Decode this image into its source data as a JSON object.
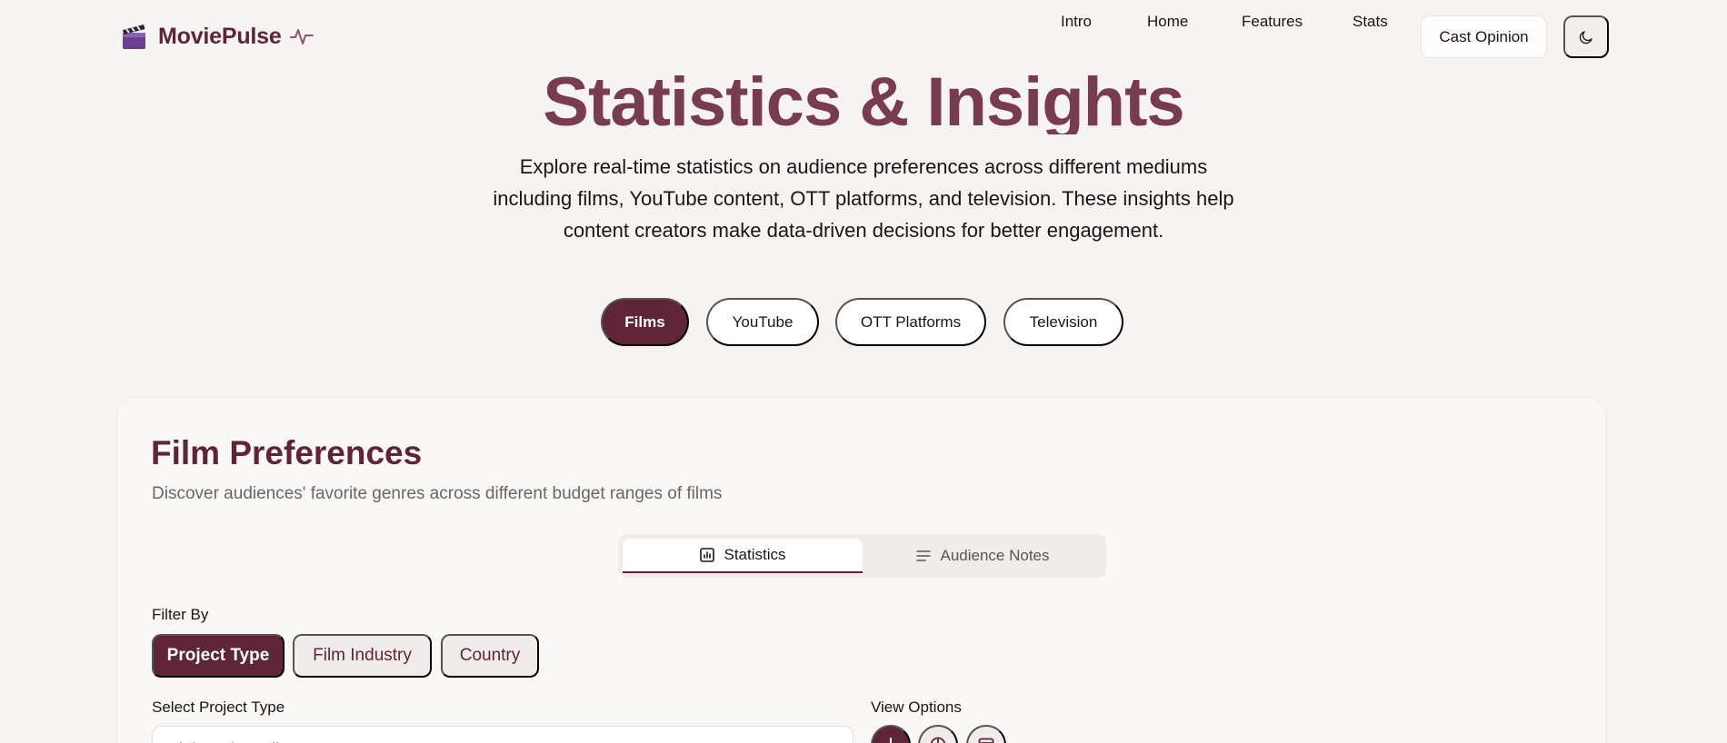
{
  "app": {
    "name": "MoviePulse"
  },
  "nav": {
    "links": [
      "Intro",
      "Home",
      "Features",
      "Stats"
    ],
    "cta": "Cast Opinion",
    "theme_icon": "moon-icon"
  },
  "hero": {
    "title": "Statistics & Insights",
    "description": "Explore real-time statistics on audience preferences across different mediums including films, YouTube content, OTT platforms, and television. These insights help content creators make data-driven decisions for better engagement."
  },
  "mediums": {
    "items": [
      "Films",
      "YouTube",
      "OTT Platforms",
      "Television"
    ],
    "selected": "Films"
  },
  "section": {
    "title": "Film Preferences",
    "subtitle": "Discover audiences' favorite genres across different budget ranges of films",
    "tabs": [
      "Statistics",
      "Audience Notes"
    ],
    "active_tab": "Statistics",
    "filter_label": "Filter By",
    "filters": [
      "Project Type",
      "Film Industry",
      "Country"
    ],
    "active_filter": "Project Type",
    "select_label": "Select Project Type",
    "select_value": "High Budget Films",
    "view_label": "View Options",
    "view_icons": [
      "bar-chart-icon",
      "pie-chart-icon",
      "table-icon"
    ]
  },
  "colors": {
    "brand": "#5f2437",
    "hero_title": "#773c51",
    "background": "#f7f3f2"
  }
}
